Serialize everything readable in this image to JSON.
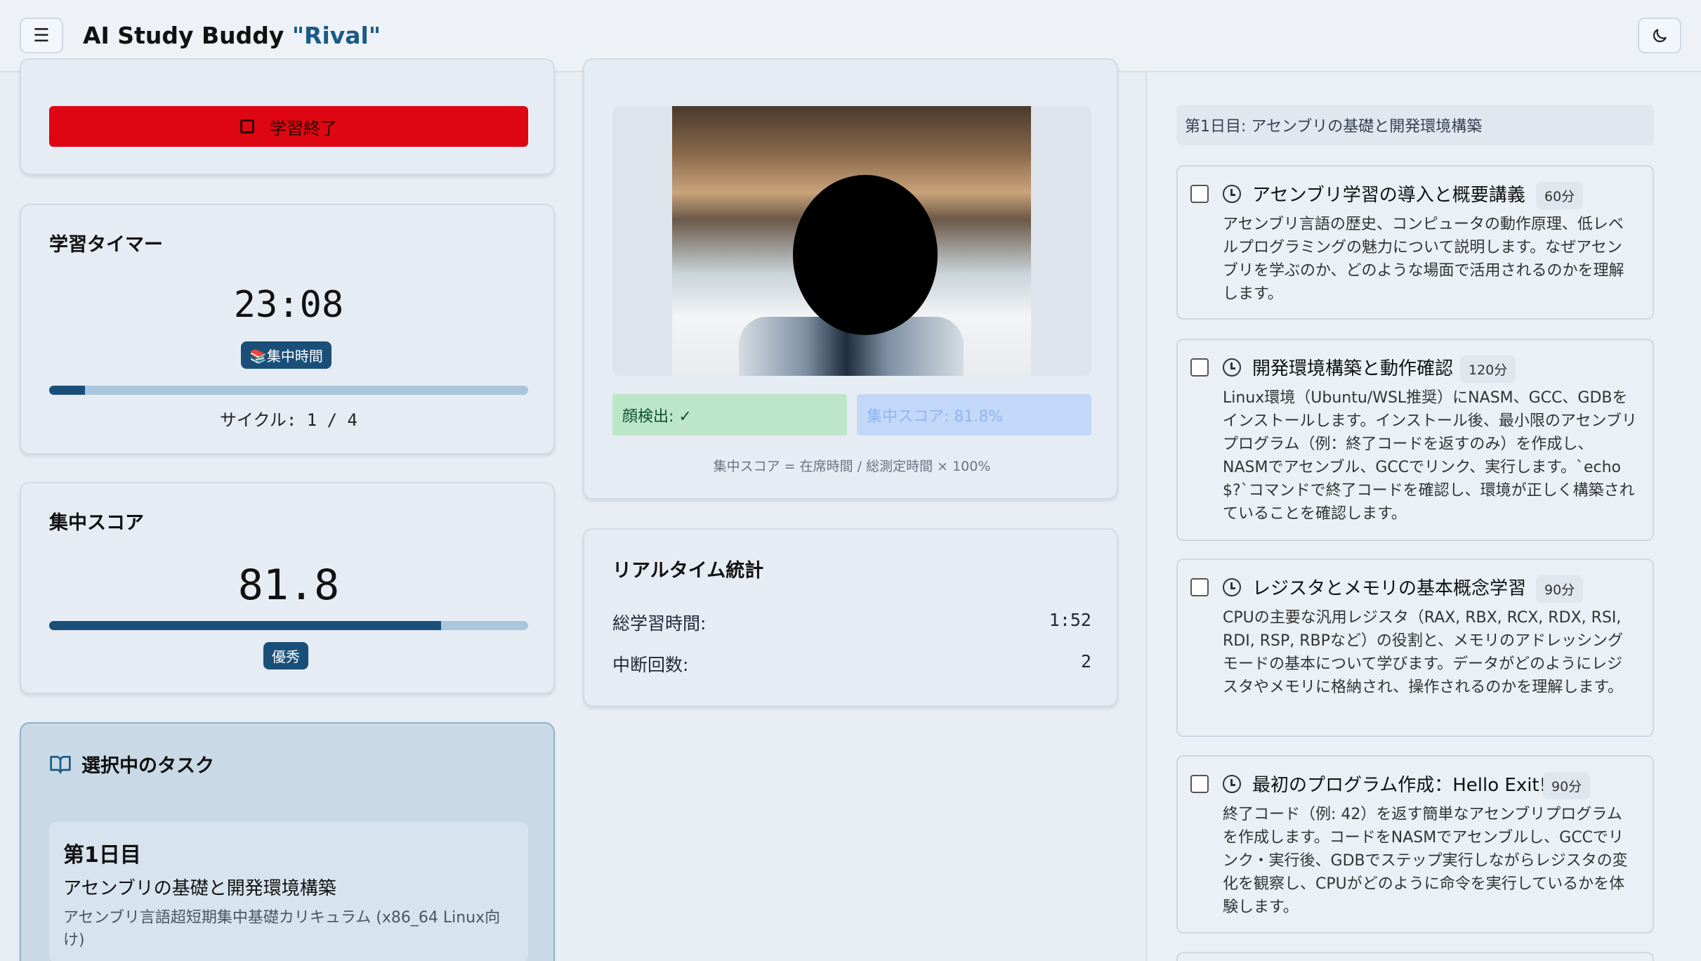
{
  "header": {
    "menu_icon": "hamburger-menu-icon",
    "title_main": "AI Study Buddy ",
    "title_accent": "\"Rival\"",
    "theme_icon": "moon-icon"
  },
  "controls": {
    "stop_label": "学習終了",
    "stop_icon": "stop-square-icon",
    "stop_color": "#dd0612"
  },
  "timer": {
    "title": "学習タイマー",
    "time": "23:08",
    "mode_badge": "📚集中時間",
    "progress": 0.075,
    "cycle_text": "サイクル: 1 / 4"
  },
  "focus": {
    "title": "集中スコア",
    "score": "81.8",
    "progress": 0.818,
    "grade_badge": "優秀"
  },
  "selected_task": {
    "title": "選択中のタスク",
    "icon": "book-icon",
    "day": "第1日目",
    "subject": "アセンブリの基礎と開発環境構築",
    "curriculum": "アセンブリ言語超短期集中基礎カリキュラム (x86_64 Linux向け)"
  },
  "camera": {
    "face_status": "顔検出: ✓",
    "focus_status": "集中スコア: 81.8%",
    "formula": "集中スコア = 在席時間 / 総測定時間 × 100%"
  },
  "stats": {
    "title": "リアルタイム統計",
    "total_label": "総学習時間:",
    "total_value": "1:52",
    "interrupt_label": "中断回数:",
    "interrupt_value": "2"
  },
  "plan": {
    "day_header": "第1日目: アセンブリの基礎と開発環境構築",
    "tasks": [
      {
        "title": "アセンブリ学習の導入と概要講義",
        "duration": "60分",
        "desc": "アセンブリ言語の歴史、コンピュータの動作原理、低レベルプログラミングの魅力について説明します。なぜアセンブリを学ぶのか、どのような場面で活用されるのかを理解します。"
      },
      {
        "title": "開発環境構築と動作確認",
        "duration": "120分",
        "desc": "Linux環境（Ubuntu/WSL推奨）にNASM、GCC、GDBをインストールします。インストール後、最小限のアセンブリプログラム（例：終了コードを返すのみ）を作成し、NASMでアセンブル、GCCでリンク、実行します。`echo $?`コマンドで終了コードを確認し、環境が正しく構築されていることを確認します。"
      },
      {
        "title": "レジスタとメモリの基本概念学習",
        "duration": "90分",
        "desc": "CPUの主要な汎用レジスタ（RAX, RBX, RCX, RDX, RSI, RDI, RSP, RBPなど）の役割と、メモリのアドレッシングモードの基本について学びます。データがどのようにレジスタやメモリに格納され、操作されるのかを理解します。"
      },
      {
        "title": "最初のプログラム作成：Hello Exit!",
        "duration": "90分",
        "desc": "終了コード（例: 42）を返す簡単なアセンブリプログラムを作成します。コードをNASMでアセンブルし、GCCでリンク・実行後、GDBでステップ実行しながらレジスタの変化を観察し、CPUがどのように命令を実行しているかを体験します。"
      }
    ]
  }
}
